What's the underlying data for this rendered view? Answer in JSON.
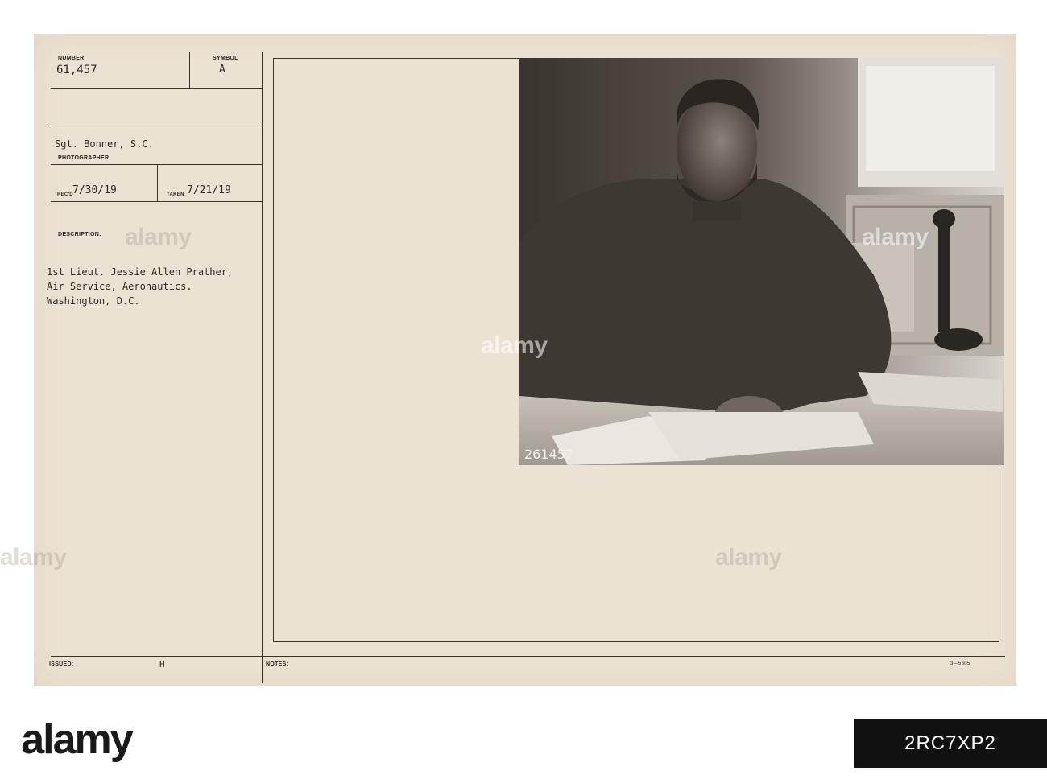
{
  "card": {
    "number_label": "NUMBER",
    "number_value": "61,457",
    "symbol_label": "SYMBOL",
    "symbol_value": "A",
    "photographer_value": "Sgt. Bonner, S.C.",
    "photographer_label": "PHOTOGRAPHER",
    "recd_label": "REC'D",
    "recd_value": "7/30/19",
    "taken_label": "TAKEN",
    "taken_value": "7/21/19",
    "description_label": "DESCRIPTION:",
    "description_lines": [
      "1st Lieut. Jessie Allen Prather,",
      "Air Service, Aeronautics.",
      "Washington, D.C."
    ],
    "issued_label": "ISSUED:",
    "issued_value": "H",
    "notes_label": "NOTES:",
    "form_code": "3—5605"
  },
  "photo": {
    "negative_number": "261457"
  },
  "watermark": {
    "text": "alamy",
    "stock_id": "2RC7XP2"
  },
  "colors": {
    "card_background": "#ece2d4",
    "ink": "#2e2924"
  }
}
